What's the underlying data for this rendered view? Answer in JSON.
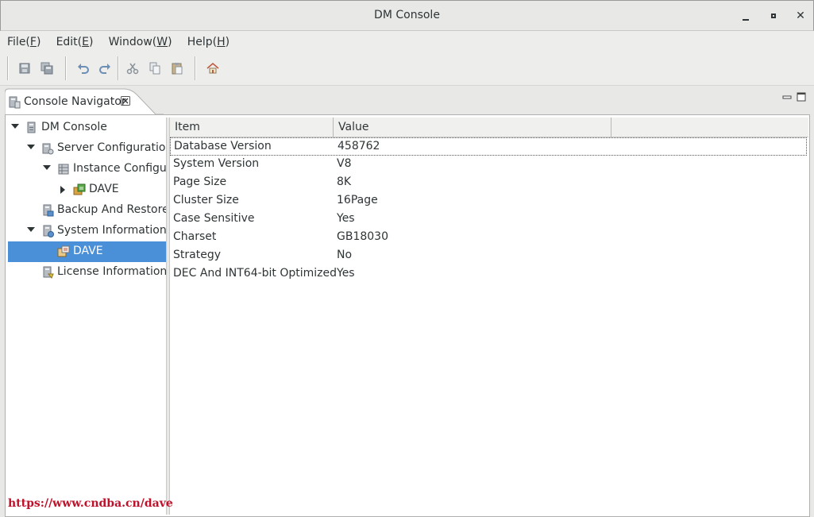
{
  "window": {
    "title": "DM Console"
  },
  "menu": [
    {
      "label": "File(F)",
      "pre": "File(",
      "key": "F",
      "post": ")"
    },
    {
      "label": "Edit(E)",
      "pre": "Edit(",
      "key": "E",
      "post": ")"
    },
    {
      "label": "Window(W)",
      "pre": "Window(",
      "key": "W",
      "post": ")"
    },
    {
      "label": "Help(H)",
      "pre": "Help(",
      "key": "H",
      "post": ")"
    }
  ],
  "toolbar": {
    "icons": [
      "save-icon",
      "save-all-icon",
      "undo-icon",
      "redo-icon",
      "cut-icon",
      "copy-icon",
      "paste-icon",
      "home-icon"
    ]
  },
  "view": {
    "tab_label": "Console Navigator"
  },
  "tree": [
    {
      "label": "DM Console",
      "expanded": true,
      "icon": "console-icon"
    },
    {
      "label": "Server Configuration",
      "expanded": true,
      "icon": "server-config-icon"
    },
    {
      "label": "Instance Configura",
      "expanded": true,
      "icon": "instance-config-icon"
    },
    {
      "label": "DAVE",
      "expanded": false,
      "icon": "instance-icon"
    },
    {
      "label": "Backup And Restore",
      "icon": "backup-icon"
    },
    {
      "label": "System Information",
      "expanded": true,
      "icon": "system-info-icon"
    },
    {
      "label": "DAVE",
      "icon": "instance-info-icon",
      "selected": true
    },
    {
      "label": "License Information",
      "icon": "license-icon"
    }
  ],
  "table": {
    "columns": [
      "Item",
      "Value"
    ],
    "rows": [
      {
        "item": "Database Version",
        "value": "458762"
      },
      {
        "item": "System Version",
        "value": "V8"
      },
      {
        "item": "Page Size",
        "value": "8K"
      },
      {
        "item": "Cluster Size",
        "value": "16Page"
      },
      {
        "item": "Case Sensitive",
        "value": "Yes"
      },
      {
        "item": "Charset",
        "value": "GB18030"
      },
      {
        "item": "Strategy",
        "value": "No"
      },
      {
        "item": "DEC And INT64-bit Optimized",
        "value": "Yes"
      }
    ]
  },
  "watermark": "https://www.cndba.cn/dave",
  "colors": {
    "selection": "#4a90d9",
    "watermark": "#c0102a"
  }
}
